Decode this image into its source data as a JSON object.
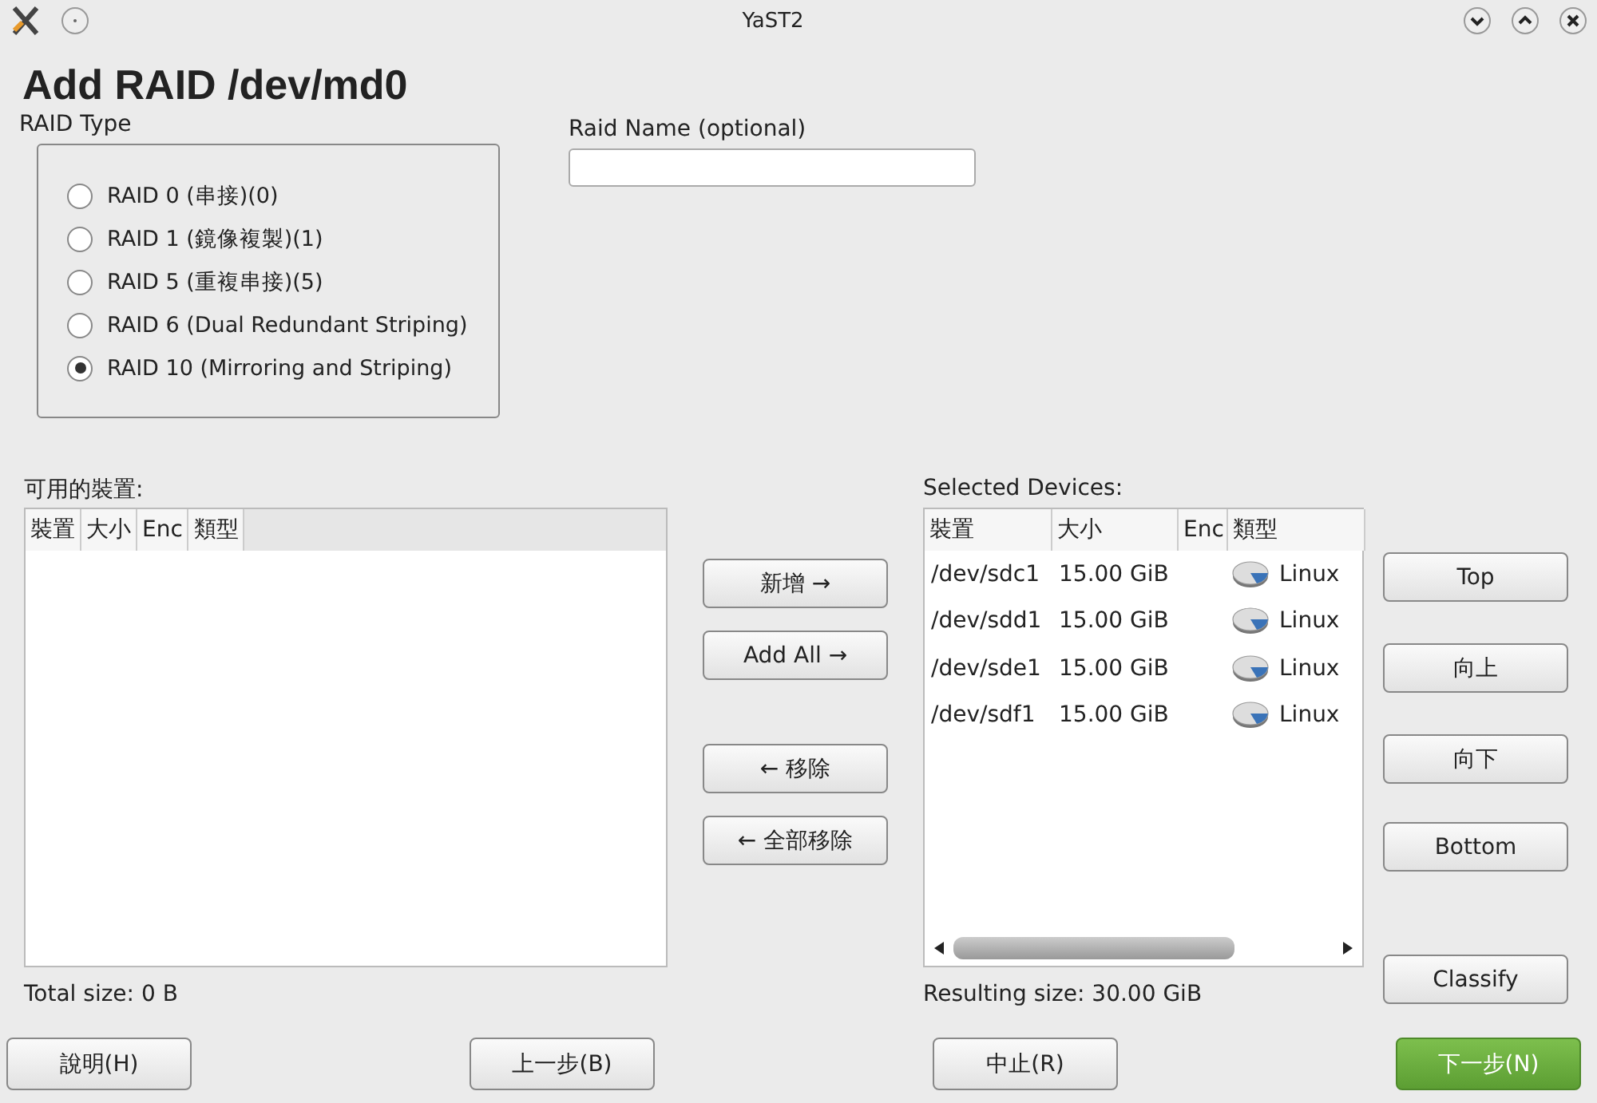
{
  "window": {
    "title": "YaST2"
  },
  "heading": "Add RAID /dev/md0",
  "raid_type": {
    "label": "RAID Type",
    "options": [
      {
        "label": "RAID 0 (串接)(0)",
        "selected": false
      },
      {
        "label": "RAID 1 (鏡像複製)(1)",
        "selected": false
      },
      {
        "label": "RAID 5 (重複串接)(5)",
        "selected": false
      },
      {
        "label": "RAID 6  (Dual Redundant Striping)",
        "selected": false
      },
      {
        "label": "RAID 10  (Mirroring and Striping)",
        "selected": true
      }
    ]
  },
  "raid_name": {
    "label": "Raid Name (optional)"
  },
  "available": {
    "label": "可用的裝置:",
    "columns": [
      "裝置",
      "大小",
      "Enc",
      "類型"
    ],
    "total": "Total size: 0 B"
  },
  "transfer_buttons": [
    "新增 →",
    "Add All →",
    "← 移除",
    "← 全部移除"
  ],
  "selected_devices": {
    "label": "Selected Devices:",
    "columns": [
      "裝置",
      "大小",
      "Enc",
      "類型"
    ],
    "rows": [
      {
        "device": "/dev/sdc1",
        "size": "15.00 GiB",
        "type": "Linux"
      },
      {
        "device": "/dev/sdd1",
        "size": "15.00 GiB",
        "type": "Linux"
      },
      {
        "device": "/dev/sde1",
        "size": "15.00 GiB",
        "type": "Linux"
      },
      {
        "device": "/dev/sdf1",
        "size": "15.00 GiB",
        "type": "Linux"
      }
    ],
    "total": "Resulting size: 30.00 GiB"
  },
  "order_buttons": [
    "Top",
    "向上",
    "向下",
    "Bottom",
    "Classify"
  ],
  "footer_buttons": [
    {
      "label": "說明(H)",
      "kind": "normal"
    },
    {
      "label": "上一步(B)",
      "kind": "normal"
    },
    {
      "label": "中止(R)",
      "kind": "normal"
    },
    {
      "label": "下一步(N)",
      "kind": "primary"
    }
  ]
}
